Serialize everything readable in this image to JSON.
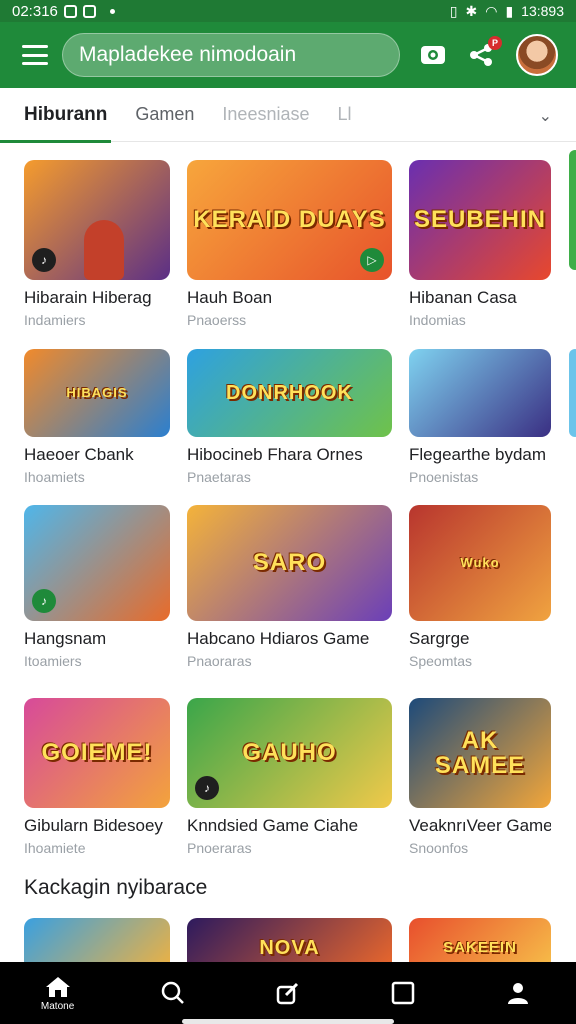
{
  "status_bar": {
    "time": "02:316",
    "clock": "13:893"
  },
  "top_bar": {
    "search_value": "Mapladekee nimodoain",
    "badge_count": "P"
  },
  "tabs": [
    {
      "label": "Hiburann"
    },
    {
      "label": "Gamen"
    },
    {
      "label": "Ineesniase"
    },
    {
      "label": "Ll"
    }
  ],
  "rows": [
    {
      "items": [
        {
          "title": "Hibarain Hiberag",
          "sub": "Indamiers",
          "art": "",
          "colors": [
            "#f59c2d",
            "#5b2f86"
          ]
        },
        {
          "title": "Hauh Boan",
          "sub": "Pnaoerss",
          "art": "KERAID DUAYS",
          "colors": [
            "#f7a63c",
            "#e7532b"
          ]
        },
        {
          "title": "Hibanan Casa",
          "sub": "Indomias",
          "art": "SEUBEHIN",
          "colors": [
            "#6a2fb0",
            "#e8482d"
          ]
        }
      ]
    },
    {
      "items": [
        {
          "title": "Haeoer Cbank",
          "sub": "Ihoamiets",
          "art": "HIBAGIS",
          "colors": [
            "#f18a2b",
            "#2b7fcf"
          ]
        },
        {
          "title": "Hibocineb Fhara Ornes",
          "sub": "Pnaetaras",
          "art": "DONRHOOK",
          "colors": [
            "#2ea1e0",
            "#6fc24a"
          ]
        },
        {
          "title": "Flegearthe bydam",
          "sub": "Pnoenistas",
          "art": "",
          "colors": [
            "#7fd2f0",
            "#3a2f83"
          ]
        }
      ]
    },
    {
      "items": [
        {
          "title": "Hangsnam",
          "sub": "Itoamiers",
          "art": "",
          "colors": [
            "#4fb6ea",
            "#e86b2a"
          ]
        },
        {
          "title": "Habcano Hdiaros Game",
          "sub": "Pnaoraras",
          "art": "SARO",
          "colors": [
            "#f4b33a",
            "#6b3fb8"
          ]
        },
        {
          "title": "Sargrge",
          "sub": "Speomtas",
          "art": "Wuko",
          "colors": [
            "#b8352e",
            "#f0a340"
          ]
        }
      ]
    },
    {
      "items": [
        {
          "title": "Gibularn Bidesoey",
          "sub": "Ihoamiete",
          "art": "GOIEME!",
          "colors": [
            "#d74a9a",
            "#f3a33c"
          ]
        },
        {
          "title": "Knndsied Game Ciahe",
          "sub": "Pnoeraras",
          "art": "GAUHO",
          "colors": [
            "#3aa64a",
            "#f0c94a"
          ]
        },
        {
          "title": "VeaknrıVeer Game",
          "sub": "Snoonfos",
          "art": "AK SAMEE",
          "colors": [
            "#1d4a7a",
            "#f2a63a"
          ]
        }
      ]
    }
  ],
  "section": {
    "title": "Kackagin nyibarace"
  },
  "bottom_row": [
    {
      "art": "",
      "colors": [
        "#3aa0e0",
        "#f5b23b"
      ]
    },
    {
      "art": "NOVA",
      "colors": [
        "#2d1a5e",
        "#f06a2a"
      ]
    },
    {
      "art": "SAKEEIN",
      "colors": [
        "#e84f2d",
        "#f7c24a"
      ]
    }
  ],
  "bottom_nav": {
    "home_label": "Matone"
  }
}
